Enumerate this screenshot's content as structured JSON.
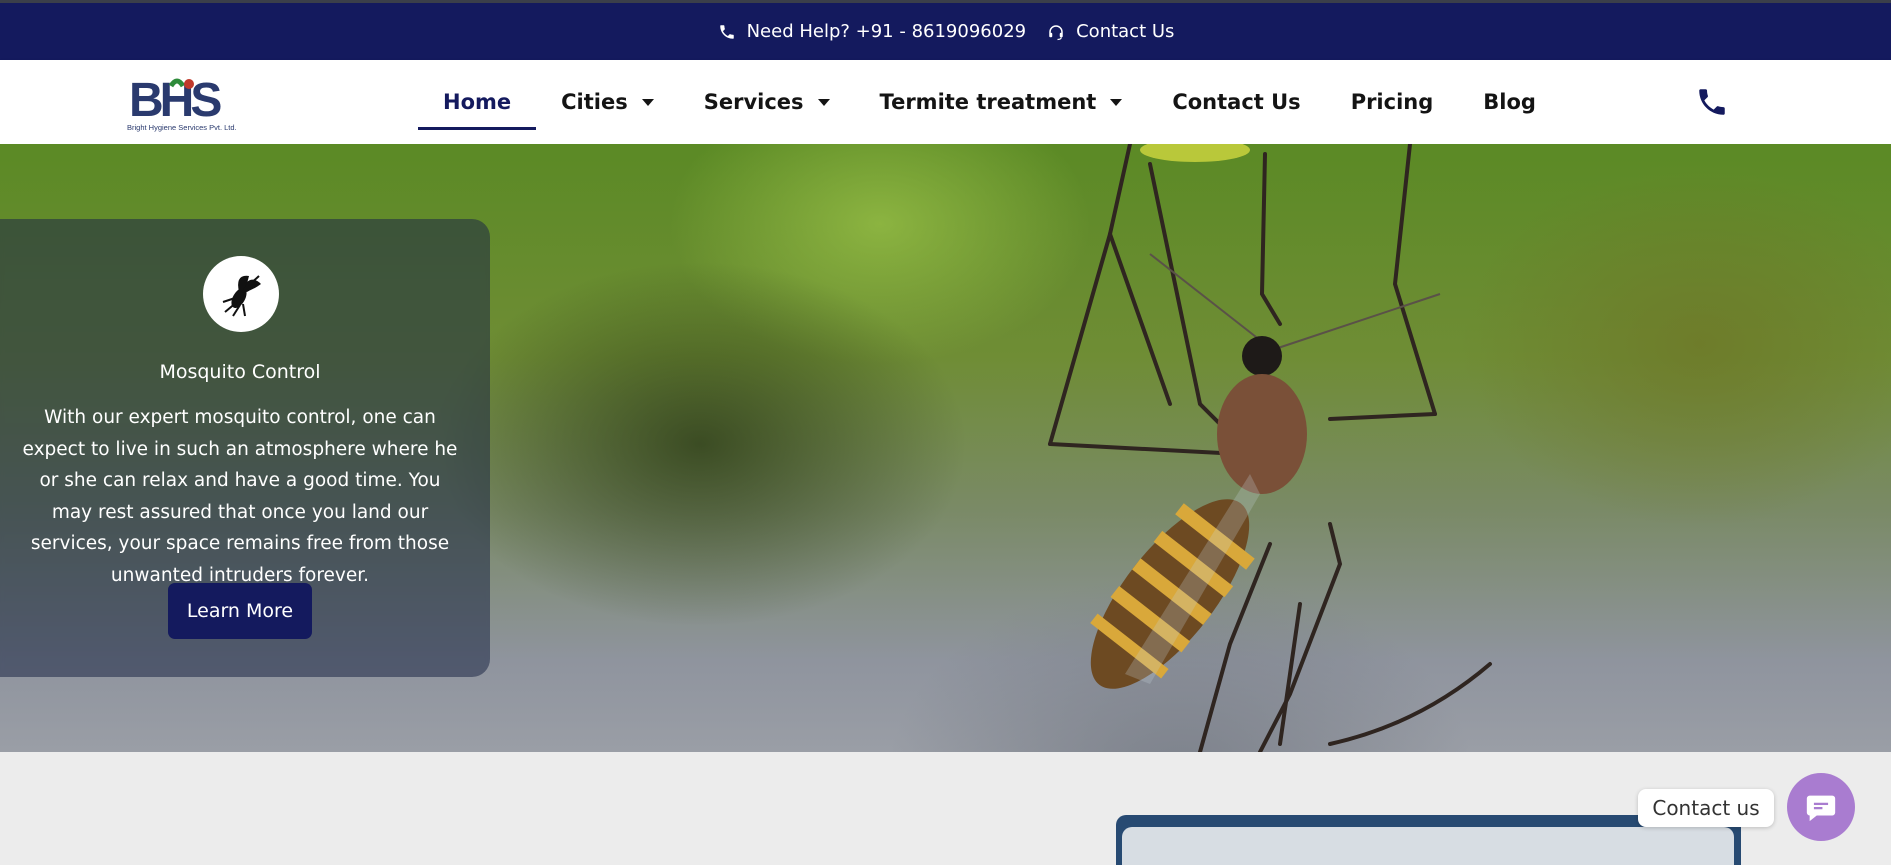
{
  "topbar": {
    "help_text": "Need Help? +91 - 8619096029",
    "contact_text": "Contact Us",
    "bg_color": "#141a5e"
  },
  "logo": {
    "mark": "BHS",
    "tagline": "Bright Hygiene Services Pvt. Ltd."
  },
  "nav": {
    "items": [
      {
        "label": "Home",
        "active": true,
        "dropdown": false
      },
      {
        "label": "Cities",
        "dropdown": true
      },
      {
        "label": "Services",
        "dropdown": true
      },
      {
        "label": "Termite treatment",
        "dropdown": true
      },
      {
        "label": "Contact Us",
        "dropdown": false
      },
      {
        "label": "Pricing",
        "dropdown": false
      },
      {
        "label": "Blog",
        "dropdown": false
      }
    ],
    "phone_icon": "phone-icon"
  },
  "hero": {
    "card": {
      "icon": "mosquito-icon",
      "title": "Mosquito Control",
      "body": "With our expert mosquito control, one can expect to live in such an atmosphere where he or she can relax and have a good time. You may rest assured that once you land our services, your space remains free from those unwanted intruders forever.",
      "button_label": "Learn More"
    }
  },
  "chat": {
    "label": "Contact us",
    "icon": "chat-icon",
    "color": "#a97cd0"
  }
}
